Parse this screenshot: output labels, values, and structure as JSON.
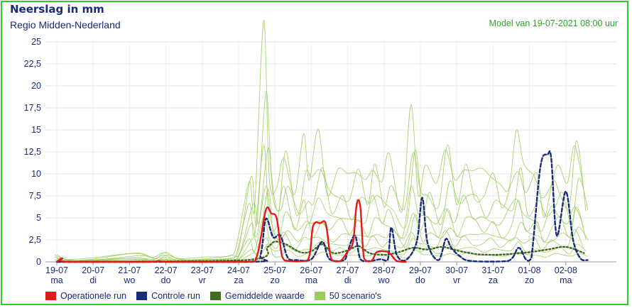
{
  "header": {
    "title": "Neerslag in mm",
    "subtitle": "Regio Midden-Nederland",
    "model_run": "Model van 19-07-2021 08:00 uur"
  },
  "colors": {
    "frame": "#2ecc2e",
    "operationele": "#e31a1a",
    "controle": "#1a2b7a",
    "gemiddelde": "#3f6b1e",
    "scenarios": "#9acd5a"
  },
  "chart_data": {
    "type": "line",
    "title": "Neerslag in mm",
    "ylabel": "",
    "ylim": [
      0,
      25
    ],
    "yticks": [
      "0",
      "2,5",
      "5",
      "7,5",
      "10",
      "12,5",
      "15",
      "17,5",
      "20",
      "22,5",
      "25"
    ],
    "x_categories": [
      {
        "date": "19-07",
        "day": "ma"
      },
      {
        "date": "20-07",
        "day": "di"
      },
      {
        "date": "21-07",
        "day": "wo"
      },
      {
        "date": "22-07",
        "day": "do"
      },
      {
        "date": "23-07",
        "day": "vr"
      },
      {
        "date": "24-07",
        "day": "za"
      },
      {
        "date": "25-07",
        "day": "zo"
      },
      {
        "date": "26-07",
        "day": "ma"
      },
      {
        "date": "27-07",
        "day": "di"
      },
      {
        "date": "28-07",
        "day": "wo"
      },
      {
        "date": "29-07",
        "day": "do"
      },
      {
        "date": "30-07",
        "day": "vr"
      },
      {
        "date": "31-07",
        "day": "za"
      },
      {
        "date": "01-08",
        "day": "zo"
      },
      {
        "date": "02-08",
        "day": "ma"
      }
    ],
    "series": [
      {
        "name": "Operationele run",
        "style": "solid",
        "points": [
          [
            0,
            0
          ],
          [
            0.15,
            0.4
          ],
          [
            0.3,
            0
          ],
          [
            2.5,
            0
          ],
          [
            2.8,
            0.1
          ],
          [
            3.1,
            0
          ],
          [
            5.2,
            0
          ],
          [
            5.5,
            0.6
          ],
          [
            5.75,
            5.9
          ],
          [
            5.9,
            5.5
          ],
          [
            6.05,
            4.9
          ],
          [
            6.2,
            0.6
          ],
          [
            6.4,
            0.1
          ],
          [
            6.9,
            0.2
          ],
          [
            7.05,
            4.1
          ],
          [
            7.25,
            4.4
          ],
          [
            7.4,
            4.3
          ],
          [
            7.55,
            0.3
          ],
          [
            7.8,
            0.1
          ],
          [
            8.0,
            1.2
          ],
          [
            8.15,
            2.3
          ],
          [
            8.25,
            6.6
          ],
          [
            8.35,
            6.2
          ],
          [
            8.45,
            0.4
          ],
          [
            8.65,
            0.1
          ],
          [
            8.8,
            1.1
          ],
          [
            9.0,
            1.2
          ],
          [
            9.15,
            1.0
          ],
          [
            9.35,
            0.1
          ],
          [
            9.6,
            0
          ]
        ]
      },
      {
        "name": "Controle run",
        "style": "dashed",
        "points": [
          [
            0,
            0
          ],
          [
            5.3,
            0
          ],
          [
            5.6,
            0.8
          ],
          [
            5.75,
            4.9
          ],
          [
            5.95,
            2.8
          ],
          [
            6.15,
            3.0
          ],
          [
            6.35,
            0.5
          ],
          [
            6.6,
            0.2
          ],
          [
            7.0,
            0.3
          ],
          [
            7.3,
            2.3
          ],
          [
            7.5,
            0.3
          ],
          [
            7.9,
            0.2
          ],
          [
            8.0,
            1.2
          ],
          [
            8.2,
            3.0
          ],
          [
            8.35,
            0.3
          ],
          [
            8.6,
            0.1
          ],
          [
            8.9,
            0.3
          ],
          [
            9.1,
            0.2
          ],
          [
            9.2,
            3.9
          ],
          [
            9.35,
            0.8
          ],
          [
            9.6,
            0.2
          ],
          [
            9.9,
            2.3
          ],
          [
            10.05,
            7.3
          ],
          [
            10.2,
            2.1
          ],
          [
            10.5,
            0.2
          ],
          [
            10.7,
            2.6
          ],
          [
            10.85,
            1.6
          ],
          [
            11.1,
            0.6
          ],
          [
            11.4,
            0.1
          ],
          [
            12.4,
            0.1
          ],
          [
            12.7,
            1.6
          ],
          [
            12.9,
            0.3
          ],
          [
            13.05,
            0.4
          ],
          [
            13.3,
            10.8
          ],
          [
            13.5,
            12.2
          ],
          [
            13.6,
            11.7
          ],
          [
            13.75,
            3.0
          ],
          [
            14.0,
            8.0
          ],
          [
            14.2,
            2.5
          ],
          [
            14.4,
            0.4
          ],
          [
            14.6,
            0.2
          ]
        ]
      },
      {
        "name": "Gemiddelde waarde",
        "style": "dotted",
        "points": [
          [
            0,
            0
          ],
          [
            5.2,
            0.2
          ],
          [
            5.8,
            1.7
          ],
          [
            6.0,
            2.3
          ],
          [
            6.3,
            2.0
          ],
          [
            6.7,
            1.1
          ],
          [
            7.0,
            1.2
          ],
          [
            7.3,
            2.0
          ],
          [
            7.6,
            1.0
          ],
          [
            8.0,
            1.3
          ],
          [
            8.3,
            1.8
          ],
          [
            8.6,
            1.0
          ],
          [
            9.0,
            0.8
          ],
          [
            9.4,
            1.1
          ],
          [
            9.8,
            1.6
          ],
          [
            10.2,
            1.4
          ],
          [
            10.6,
            1.7
          ],
          [
            11.0,
            1.3
          ],
          [
            11.5,
            0.9
          ],
          [
            12.0,
            0.8
          ],
          [
            12.5,
            0.9
          ],
          [
            13.0,
            1.1
          ],
          [
            13.5,
            1.4
          ],
          [
            14.0,
            1.7
          ],
          [
            14.5,
            1.0
          ]
        ]
      },
      {
        "name": "50 scenario's",
        "style": "band",
        "points": [
          [
            0,
            1.0
          ],
          [
            0.3,
            0.3
          ],
          [
            1,
            0.4
          ],
          [
            2.2,
            1.1
          ],
          [
            2.7,
            0.5
          ],
          [
            3.0,
            1.3
          ],
          [
            3.4,
            0.4
          ],
          [
            4.2,
            0.5
          ],
          [
            4.8,
            0.8
          ],
          [
            5.0,
            1.8
          ],
          [
            5.35,
            11.4
          ],
          [
            5.5,
            6.5
          ],
          [
            5.75,
            24.5
          ],
          [
            5.9,
            11.0
          ],
          [
            6.1,
            8.0
          ],
          [
            6.3,
            14.8
          ],
          [
            6.6,
            8.0
          ],
          [
            6.85,
            13.0
          ],
          [
            7.0,
            10.5
          ],
          [
            7.25,
            14.5
          ],
          [
            7.5,
            9.5
          ],
          [
            7.8,
            11.0
          ],
          [
            8.05,
            9.0
          ],
          [
            8.3,
            11.5
          ],
          [
            8.55,
            9.0
          ],
          [
            8.75,
            13.0
          ],
          [
            9.0,
            9.5
          ],
          [
            9.2,
            11.0
          ],
          [
            9.55,
            6.5
          ],
          [
            9.8,
            17.2
          ],
          [
            10.0,
            9.5
          ],
          [
            10.2,
            11.5
          ],
          [
            10.5,
            8.0
          ],
          [
            10.75,
            14.5
          ],
          [
            11.0,
            9.0
          ],
          [
            11.25,
            13.0
          ],
          [
            11.5,
            10.8
          ],
          [
            11.75,
            9.5
          ],
          [
            12.0,
            11.0
          ],
          [
            12.25,
            8.5
          ],
          [
            12.5,
            10.5
          ],
          [
            12.7,
            15.6
          ],
          [
            12.9,
            10.0
          ],
          [
            13.2,
            11.0
          ],
          [
            13.4,
            7.0
          ],
          [
            13.65,
            10.8
          ],
          [
            13.85,
            11.5
          ],
          [
            14.1,
            8.0
          ],
          [
            14.3,
            15.0
          ],
          [
            14.55,
            8.0
          ]
        ]
      }
    ],
    "legend": "bottom",
    "grid": true
  }
}
